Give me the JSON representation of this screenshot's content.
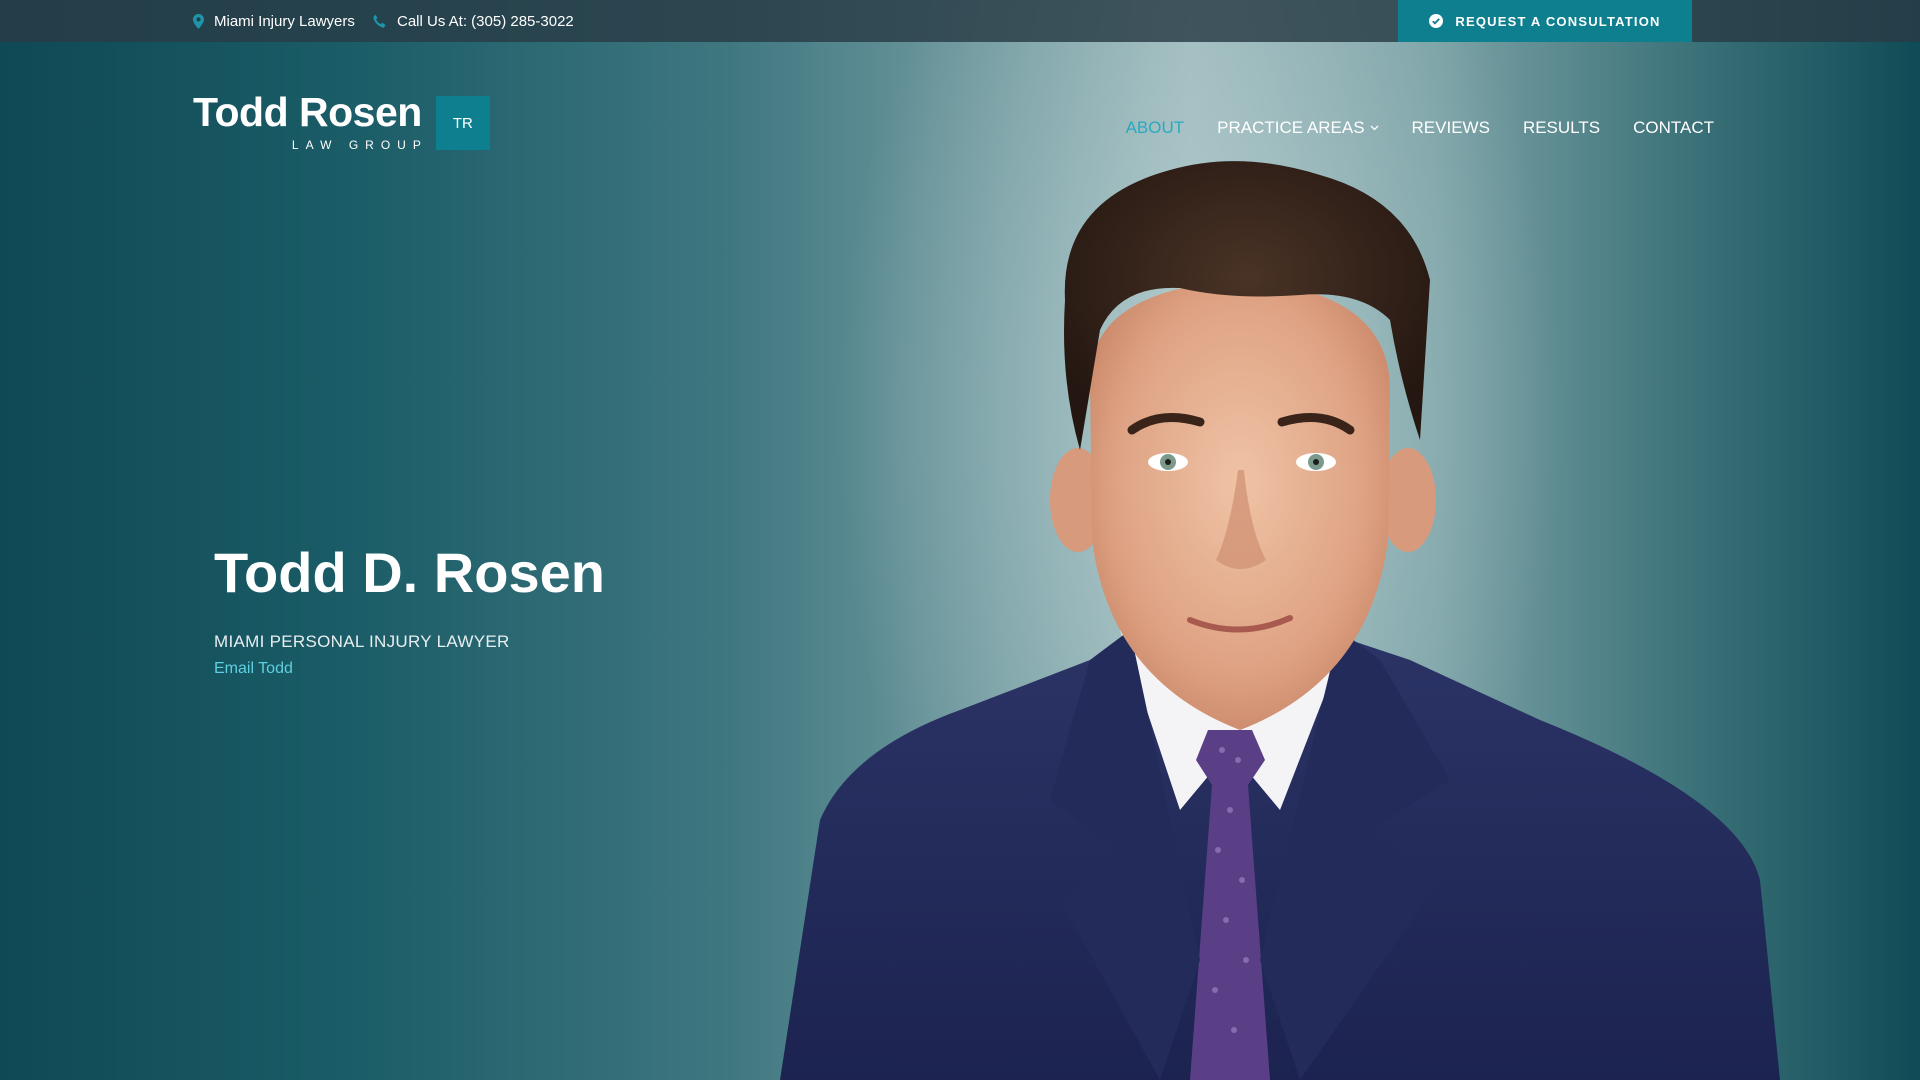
{
  "topbar": {
    "location_label": "Miami Injury Lawyers",
    "phone_label": "Call Us At: (305) 285-3022",
    "consult_button": "REQUEST A CONSULTATION"
  },
  "logo": {
    "name": "Todd Rosen",
    "subtitle": "LAW GROUP",
    "mark": "TR"
  },
  "nav": {
    "items": [
      {
        "label": "ABOUT",
        "active": true
      },
      {
        "label": "PRACTICE AREAS",
        "dropdown": true
      },
      {
        "label": "REVIEWS"
      },
      {
        "label": "RESULTS"
      },
      {
        "label": "CONTACT"
      }
    ]
  },
  "hero": {
    "title": "Todd D. Rosen",
    "subtitle": "MIAMI PERSONAL INJURY LAWYER",
    "email_link": "Email Todd"
  },
  "icons": {
    "location": "map-pin-icon",
    "phone": "phone-icon",
    "consult": "check-circle-icon",
    "dropdown": "chevron-down-icon"
  },
  "colors": {
    "accent": "#0e7f8f",
    "active_nav": "#2aa9c0",
    "email_link": "#5fd0e0",
    "topbar": "#2f4650"
  }
}
